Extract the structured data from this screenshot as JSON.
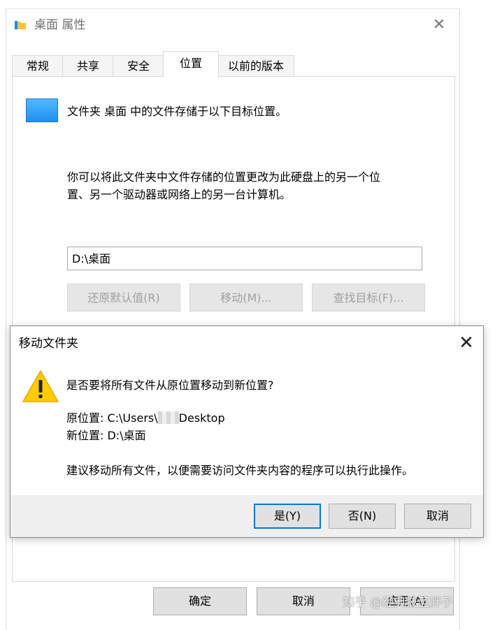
{
  "properties_window": {
    "title": "桌面 属性",
    "close_symbol": "✕",
    "tabs": [
      {
        "label": "常规",
        "active": false
      },
      {
        "label": "共享",
        "active": false
      },
      {
        "label": "安全",
        "active": false
      },
      {
        "label": "位置",
        "active": true
      },
      {
        "label": "以前的版本",
        "active": false
      }
    ],
    "location_tab": {
      "description": "文件夹 桌面 中的文件存储于以下目标位置。",
      "info_line1": "你可以将此文件夹中文件存储的位置更改为此硬盘上的另一个位",
      "info_line2": "置、另一个驱动器或网络上的另一台计算机。",
      "path_value": "D:\\桌面",
      "buttons": {
        "restore_default": "还原默认值(R)",
        "move": "移动(M)...",
        "find_target": "查找目标(F)..."
      }
    },
    "footer_buttons": {
      "ok": "确定",
      "cancel": "取消",
      "apply": "应用(A)"
    }
  },
  "move_dialog": {
    "title": "移动文件夹",
    "close_symbol": "✕",
    "question": "是否要将所有文件从原位置移动到新位置?",
    "from_prefix": "原位置: C:\\Users\\",
    "from_suffix": "Desktop",
    "to_line": "新位置: D:\\桌面",
    "suggestion": "建议移动所有文件，以便需要访问文件夹内容的程序可以执行此操作。",
    "buttons": {
      "yes": "是(Y)",
      "no": "否(N)",
      "cancel": "取消"
    }
  },
  "watermark": "知乎 @经典技蓝胖子",
  "icons": {
    "title_icon": "folder-icon",
    "folder_icon": "folder-blue-icon",
    "warning_icon": "warning-triangle-icon"
  },
  "colors": {
    "accent": "#0078d7",
    "warning_yellow": "#ffcc00",
    "folder_blue": "#2196f3"
  }
}
